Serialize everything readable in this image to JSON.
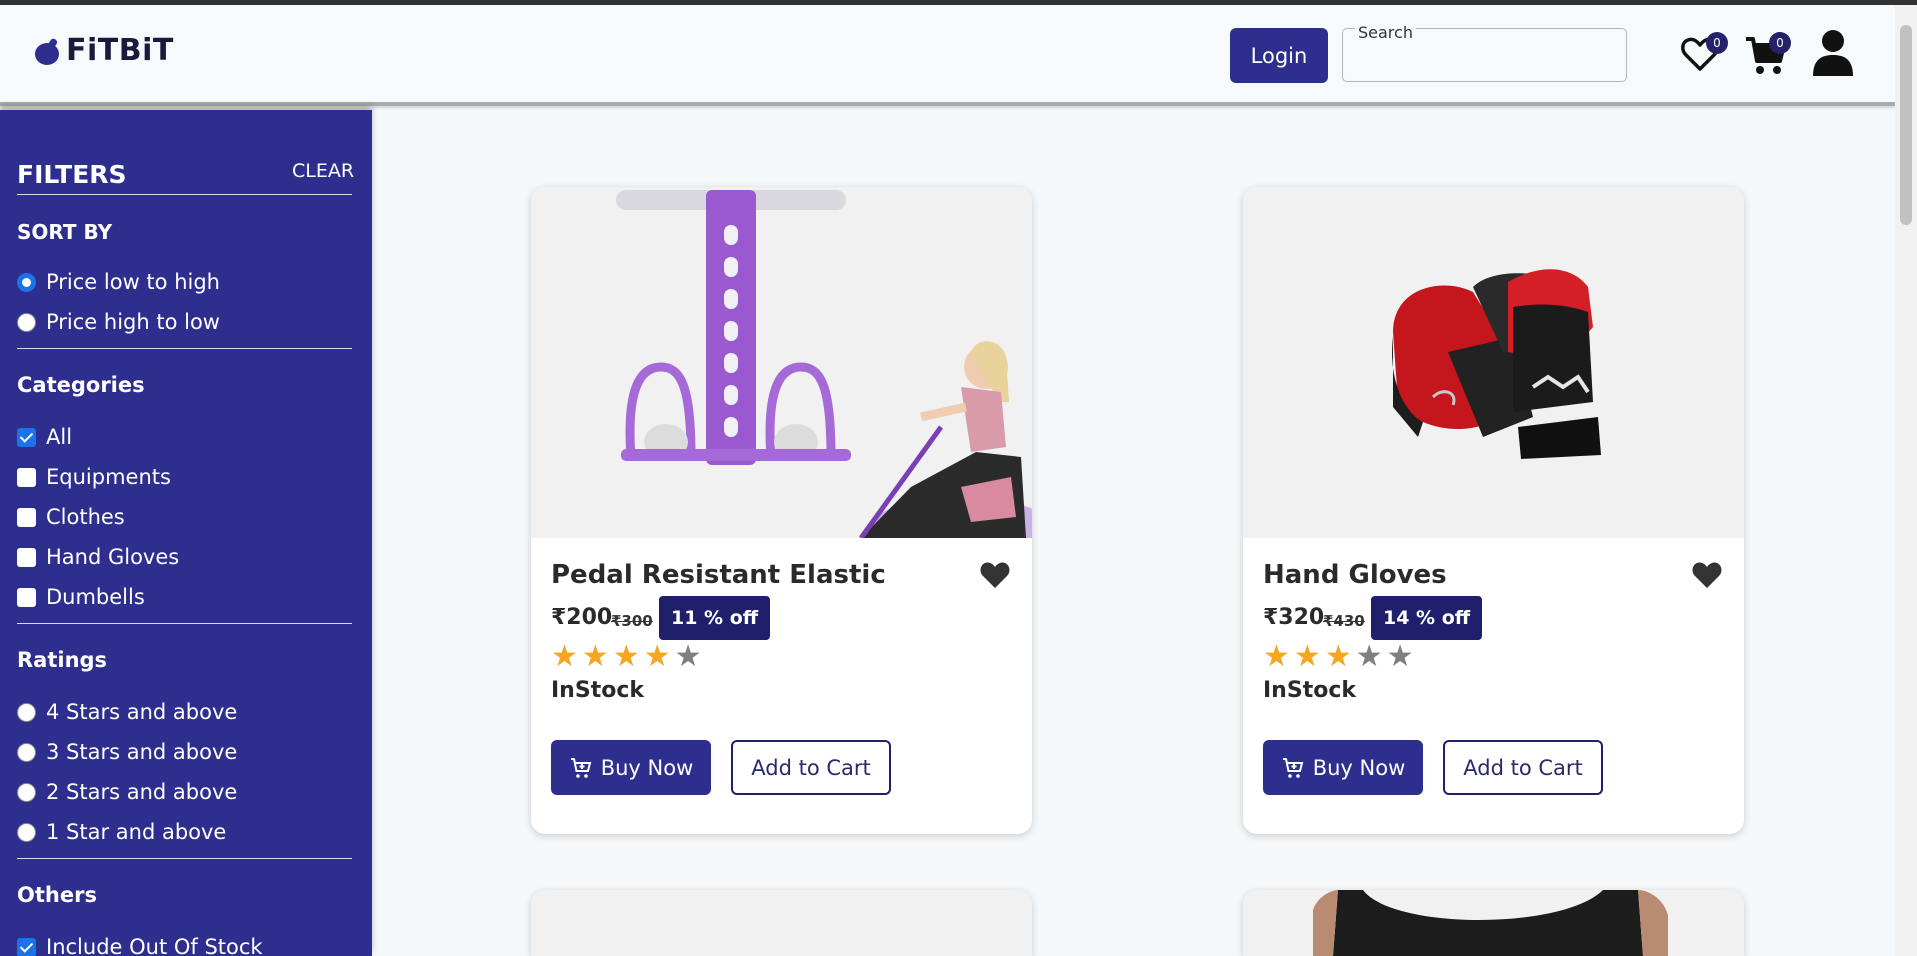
{
  "header": {
    "logo_text": "FiTBiT",
    "login_label": "Login",
    "search_label": "Search",
    "search_value": "",
    "wishlist_count": "0",
    "cart_count": "0"
  },
  "filters": {
    "title": "FILTERS",
    "clear_label": "CLEAR",
    "sort_by": {
      "title": "SORT BY",
      "options": [
        "Price low to high",
        "Price high to low"
      ],
      "selected": "Price low to high"
    },
    "categories": {
      "title": "Categories",
      "options": [
        "All",
        "Equipments",
        "Clothes",
        "Hand Gloves",
        "Dumbells"
      ],
      "checked": [
        "All"
      ]
    },
    "ratings": {
      "title": "Ratings",
      "options": [
        "4 Stars and above",
        "3 Stars and above",
        "2 Stars and above",
        "1 Star and above"
      ]
    },
    "others": {
      "title": "Others",
      "options": [
        "Include Out Of Stock"
      ],
      "checked": [
        "Include Out Of Stock"
      ]
    }
  },
  "products": [
    {
      "title": "Pedal Resistant Elastic",
      "price": "₹200",
      "mrp": "₹300",
      "discount": "11 % off",
      "rating": 4,
      "stock": "InStock",
      "buy_label": "Buy Now",
      "cart_label": "Add to Cart"
    },
    {
      "title": "Hand Gloves",
      "price": "₹320",
      "mrp": "₹430",
      "discount": "14 % off",
      "rating": 3,
      "stock": "InStock",
      "buy_label": "Buy Now",
      "cart_label": "Add to Cart"
    }
  ],
  "colors": {
    "primary": "#2e2e8f",
    "star_on": "#f5a623",
    "star_off": "#808080"
  }
}
